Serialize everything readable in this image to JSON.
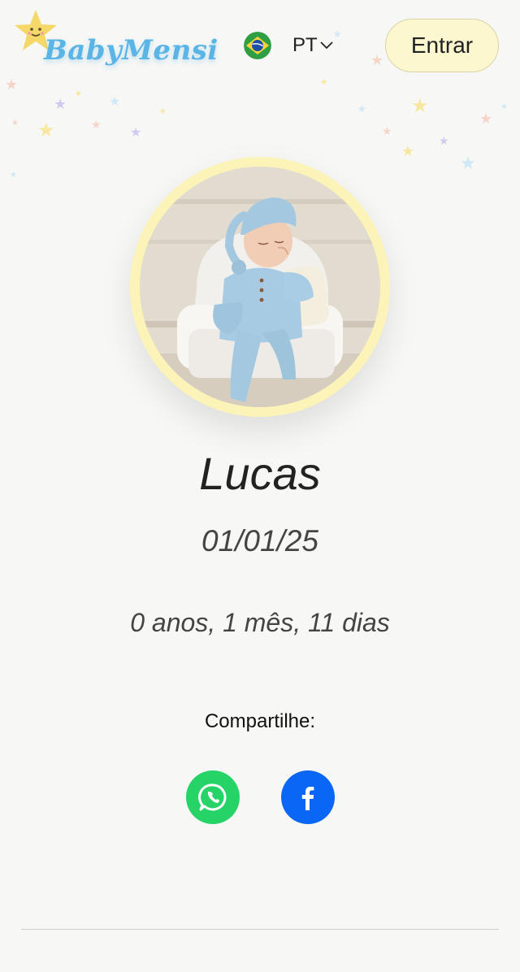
{
  "header": {
    "logo_text": "BabyMensi",
    "language": {
      "code": "PT",
      "flag_icon": "brazil-flag-icon"
    },
    "login_label": "Entrar"
  },
  "profile": {
    "name": "Lucas",
    "birth_date": "01/01/25",
    "age": "0 anos, 1 mês, 11 dias"
  },
  "share": {
    "label": "Compartilhe:",
    "buttons": [
      {
        "icon": "whatsapp-icon",
        "color": "#26d366"
      },
      {
        "icon": "facebook-icon",
        "color": "#0a66f5"
      }
    ]
  },
  "colors": {
    "background": "#f7f7f5",
    "logo_blue": "#5ab4e6",
    "login_bg": "#fdf7cf",
    "avatar_ring": "#fbf3b8",
    "whatsapp": "#26d366",
    "facebook": "#0a66f5"
  }
}
